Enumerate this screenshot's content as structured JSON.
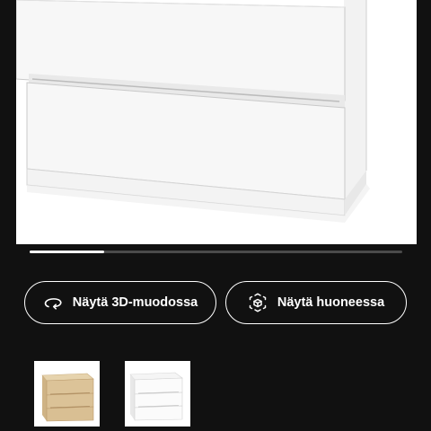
{
  "product": {
    "image_name": "white-chest-of-drawers-image"
  },
  "carousel": {
    "progress": 0.2
  },
  "actions": {
    "view_3d_label": "Näytä 3D-muodossa",
    "view_3d_icon": "rotate-3d-icon",
    "view_room_label": "Näytä huoneessa",
    "view_room_icon": "augmented-reality-icon"
  },
  "variants": [
    {
      "name": "white-stained-oak-veneer",
      "color": "#d8bf92"
    },
    {
      "name": "white",
      "color": "#ffffff"
    }
  ],
  "colors": {
    "background": "#111111",
    "text": "#ffffff",
    "accent": "#ffffff"
  }
}
